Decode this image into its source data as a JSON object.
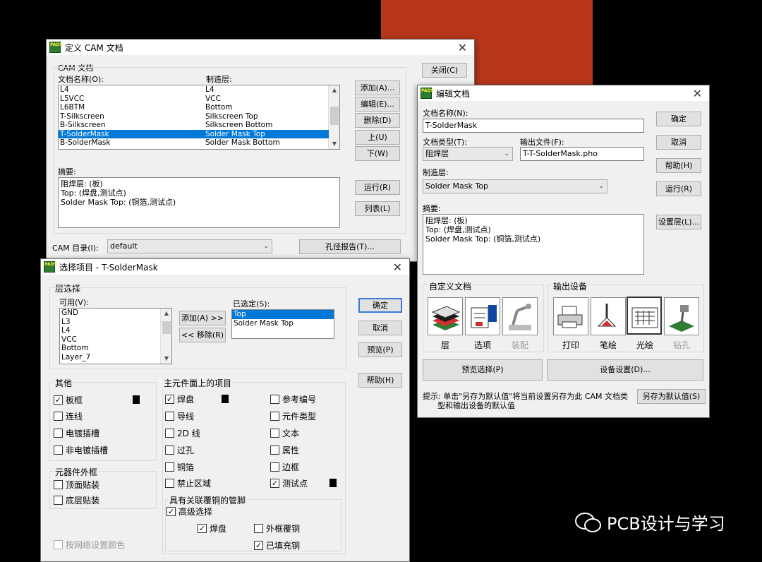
{
  "watermark": {
    "text": "PCB设计与学习"
  },
  "cam": {
    "title": "定义 CAM 文档",
    "group": "CAM 文档",
    "col_doc": "文档名称(O):",
    "col_layer": "制造层:",
    "rows": [
      [
        "L4",
        "L4"
      ],
      [
        "L5VCC",
        "VCC"
      ],
      [
        "L6BTM",
        "Bottom"
      ],
      [
        "T-Silkscreen",
        "Silkscreen Top"
      ],
      [
        "B-Silkscreen",
        "Silkscreen Bottom"
      ],
      [
        "T-SolderMask",
        "Solder Mask Top"
      ],
      [
        "B-SolderMask",
        "Solder Mask Bottom"
      ]
    ],
    "selected": 5,
    "summary_label": "摘要:",
    "summary": "阻焊层: (板)\nTop: (焊盘,测试点)\nSolder Mask Top: (铜箔,测试点)",
    "btn_add": "添加(A)...",
    "btn_edit": "编辑(E)...",
    "btn_del": "删除(D)",
    "btn_up": "上(U)",
    "btn_down": "下(W)",
    "btn_run": "运行(R)",
    "btn_list": "列表(L)",
    "btn_close": "关闭(C)",
    "btn_drill": "孔径报告(T)...",
    "dir_label": "CAM 目录(I):",
    "dir_value": "default"
  },
  "edit": {
    "title": "编辑文档",
    "name_label": "文档名称(N):",
    "name_value": "T-SolderMask",
    "type_label": "文档类型(T):",
    "type_value": "阻焊层",
    "out_label": "输出文件(F):",
    "out_value": "T-T-SolderMask.pho",
    "layer_label": "制造层:",
    "layer_value": "Solder Mask Top",
    "summary_label": "摘要:",
    "summary": "阻焊层: (板)\nTop: (焊盘,测试点)\nSolder Mask Top: (铜箔,测试点)",
    "btn_ok": "确定",
    "btn_cancel": "取消",
    "btn_help": "帮助(H)",
    "btn_run": "运行(R)",
    "btn_setlayer": "设置层(L)...",
    "custom_group": "自定义文档",
    "output_group": "输出设备",
    "tile_layer": "层",
    "tile_options": "选项",
    "tile_assembly": "装配",
    "tile_print": "打印",
    "tile_pen": "笔绘",
    "tile_photo": "光绘",
    "tile_drill": "钻孔",
    "btn_preview": "预览选择(P)",
    "btn_device": "设备设置(D)...",
    "hint": "提示: 单击\"另存为默认值\"将当前设置另存为此 CAM 文档类\n      型和输出设备的默认值",
    "btn_save_default": "另存为默认值(S)"
  },
  "selitems": {
    "title": "选择项目 - T-SolderMask",
    "layer_group": "层选择",
    "avail_label": "可用(V):",
    "avail": [
      "GND",
      "L3",
      "L4",
      "VCC",
      "Bottom",
      "Layer_7"
    ],
    "chosen_label": "已选定(S):",
    "chosen": [
      "Top",
      "Solder Mask Top"
    ],
    "btn_add": "添加(A) >>",
    "btn_remove": "<< 移除(R)",
    "btn_ok": "确定",
    "btn_cancel": "取消",
    "btn_preview": "预览(P)",
    "btn_help": "帮助(H)",
    "other_group": "其他",
    "board": "板框",
    "connect": "连线",
    "plated": "电镀插槽",
    "nonplated": "非电镀插槽",
    "comp_group": "元器件外框",
    "top_place": "顶面贴装",
    "bot_place": "底层贴装",
    "netcolor": "按网络设置颜色",
    "main_group": "主元件面上的项目",
    "pad": "焊盘",
    "trace": "导线",
    "line2d": "2D 线",
    "via": "过孔",
    "copper": "铜箔",
    "keepout": "禁止区域",
    "refdes": "参考编号",
    "parttype": "元件类型",
    "text": "文本",
    "attr": "属性",
    "outline": "边框",
    "testpoint": "测试点",
    "pin_group": "具有关联覆铜的管脚",
    "advanced": "高级选择",
    "pad2": "焊盘",
    "outer": "外框覆铜",
    "filled": "已填充铜",
    "check": "✓"
  },
  "colors": {
    "selection": "#0078d7",
    "pcb": "#b8361a"
  }
}
